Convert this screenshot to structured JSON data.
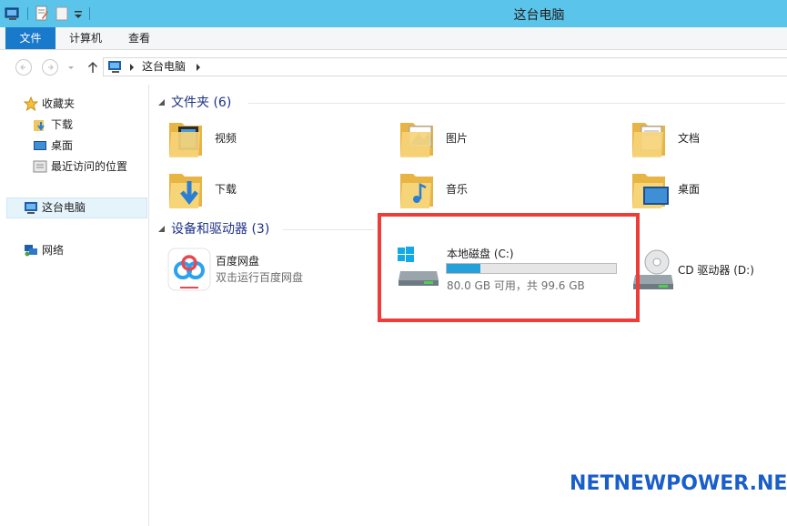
{
  "window": {
    "title": "这台电脑"
  },
  "ribbon": {
    "tabs": [
      "文件",
      "计算机",
      "查看"
    ]
  },
  "address": {
    "path": "这台电脑"
  },
  "nav": {
    "favorites": "收藏夹",
    "downloads": "下载",
    "desktop": "桌面",
    "recent": "最近访问的位置",
    "this_pc": "这台电脑",
    "network": "网络"
  },
  "folders": {
    "header": "文件夹 (6)",
    "items": [
      "视频",
      "图片",
      "文档",
      "下载",
      "音乐",
      "桌面"
    ]
  },
  "devices": {
    "header": "设备和驱动器 (3)",
    "baidu": {
      "name": "百度网盘",
      "sub": "双击运行百度网盘"
    },
    "disk_c": {
      "name": "本地磁盘 (C:)",
      "space": "80.0 GB 可用，共 99.6 GB",
      "used_fraction": 0.197
    },
    "cd": {
      "name": "CD 驱动器 (D:)"
    }
  },
  "watermark": "NETNEWPOWER.NET",
  "colors": {
    "titlebar": "#5bc4ea",
    "file_tab": "#1979ca",
    "highlight": "#ee3c39",
    "bar": "#26a0da"
  }
}
